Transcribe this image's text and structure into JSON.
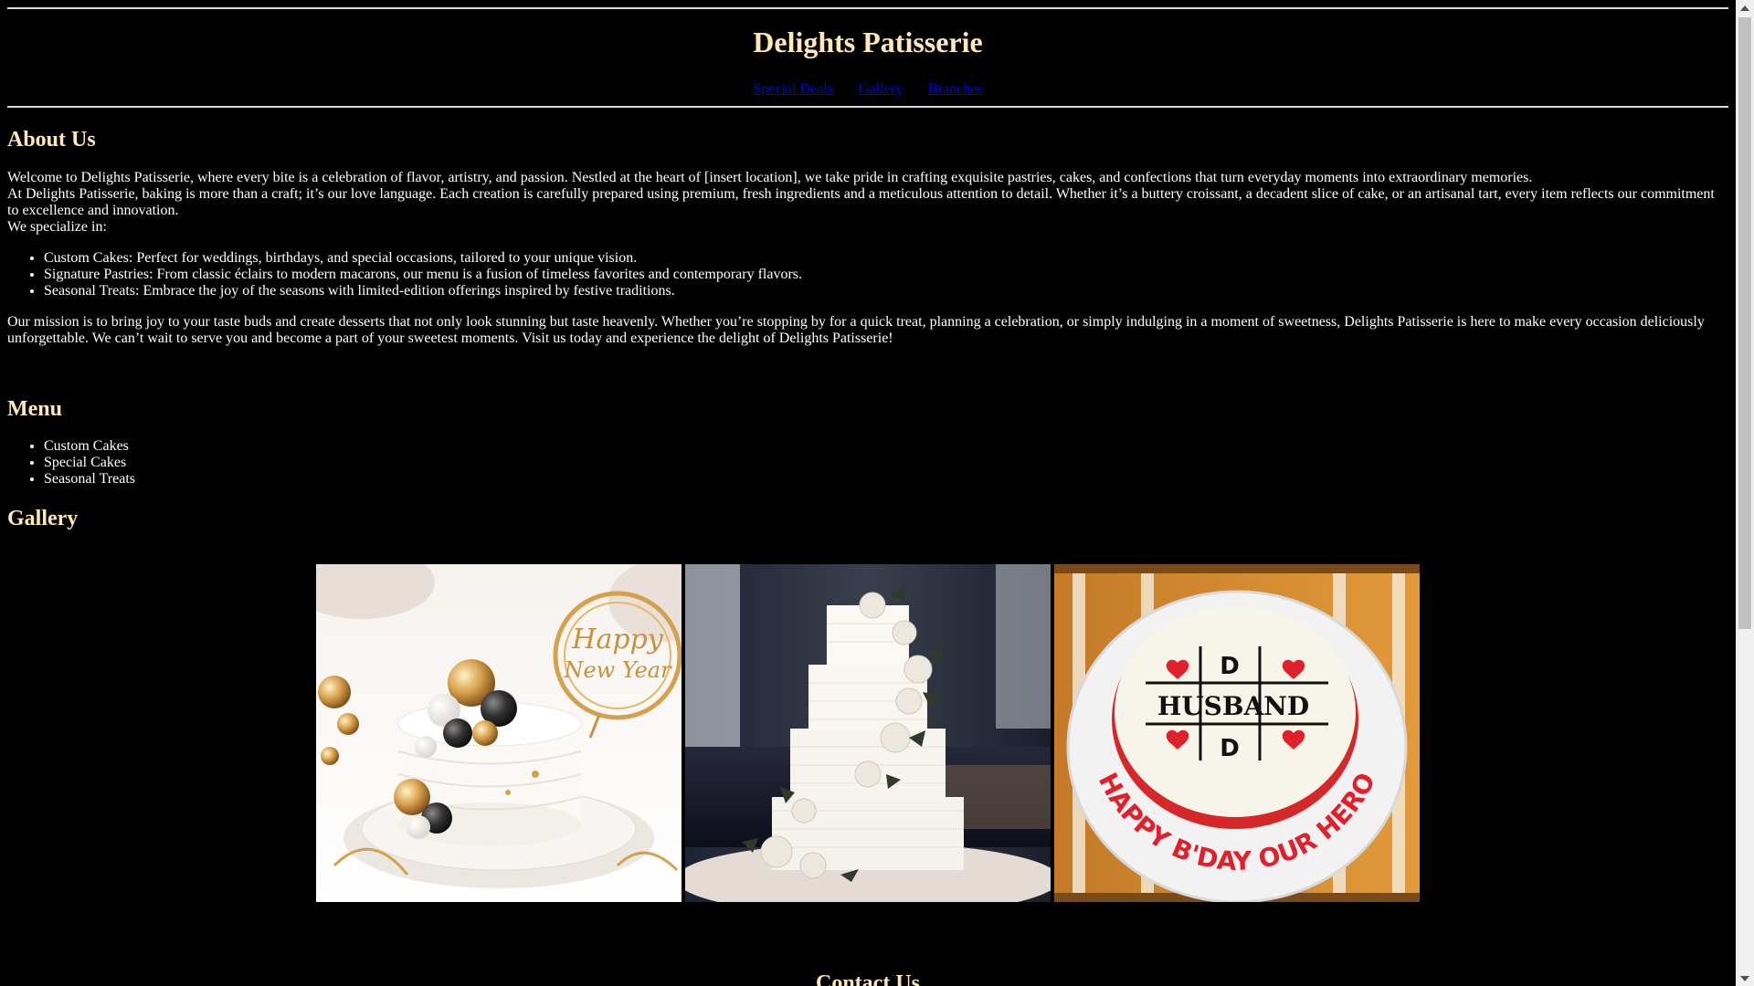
{
  "header": {
    "title": "Delights Patisserie",
    "nav": [
      "Special Deals",
      "Gallery",
      "Branches"
    ]
  },
  "about": {
    "heading": "About Us",
    "line1": "Welcome to Delights Patisserie, where every bite is a celebration of flavor, artistry, and passion. Nestled at the heart of [insert location], we take pride in crafting exquisite pastries, cakes, and confections that turn everyday moments into extraordinary memories.",
    "line2": "At Delights Patisserie, baking is more than a craft; it’s our love language. Each creation is carefully prepared using premium, fresh ingredients and a meticulous attention to detail. Whether it’s a buttery croissant, a decadent slice of cake, or an artisanal tart, every item reflects our commitment to excellence and innovation.",
    "line3": "We specialize in:",
    "specialties": [
      "Custom Cakes: Perfect for weddings, birthdays, and special occasions, tailored to your unique vision.",
      "Signature Pastries: From classic éclairs to modern macarons, our menu is a fusion of timeless favorites and contemporary flavors.",
      "Seasonal Treats: Embrace the joy of the seasons with limited-edition offerings inspired by festive traditions."
    ],
    "mission": "Our mission is to bring joy to your taste buds and create desserts that not only look stunning but taste heavenly. Whether you’re stopping by for a quick treat, planning a celebration, or simply indulging in a moment of sweetness, Delights Patisserie is here to make every occasion deliciously unforgettable. We can’t wait to serve you and become a part of your sweetest moments. Visit us today and experience the delight of Delights Patisserie!"
  },
  "menu": {
    "heading": "Menu",
    "items": [
      "Custom Cakes",
      "Special Cakes",
      "Seasonal Treats"
    ]
  },
  "gallery": {
    "heading": "Gallery",
    "images": [
      {
        "topper_line1": "Happy",
        "topper_line2": "New Year"
      },
      {},
      {
        "cake_center": "HUSBAND",
        "cake_letter": "D",
        "cake_arc": "HAPPY B'DAY OUR HERO"
      }
    ]
  },
  "contact": {
    "heading": "Contact Us"
  },
  "colors": {
    "background": "#000000",
    "heading": "#ffe9b8",
    "link": "#0000ee",
    "rule": "#d9d9d9"
  }
}
